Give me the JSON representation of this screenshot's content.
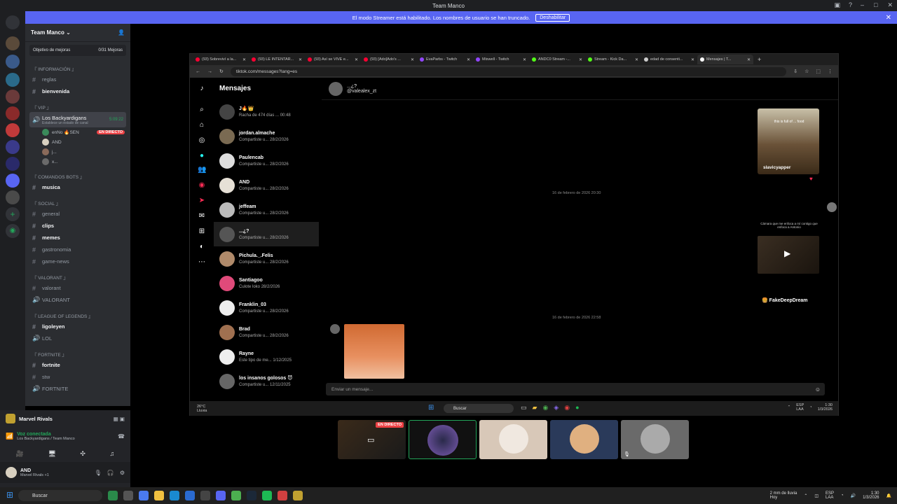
{
  "titlebar": {
    "title": "Team Manco"
  },
  "banner": {
    "text": "El modo Streamer está habilitado. Los nombres de usuario se han truncado.",
    "button": "Deshabilitar"
  },
  "server": {
    "name": "Team Manco",
    "goal_label": "Objetivo de mejoras",
    "goal_count": "0/31 Mejoras"
  },
  "channels": {
    "cat_info": "『 INFORMACIÓN 』",
    "reglas": "reglas",
    "bienvenida": "bienvenida",
    "cat_vip": "『 VIP 』",
    "voice_name": "Los Backyardigans",
    "voice_time": "5:09:22",
    "voice_status": "Establece un estado de canal",
    "vuser1": "enNo 🔥SEN",
    "vuser1_badge": "EN DIRECTO",
    "vuser2": "AND",
    "vuser3": "j...",
    "vuser4": "x...",
    "cat_bots": "『 COMANDOS BOTS 』",
    "musica": "musica",
    "cat_social": "『 SOCIAL 』",
    "general": "general",
    "clips": "clips",
    "memes": "memes",
    "gastronomia": "gastronomia",
    "game_news": "game-news",
    "cat_valorant": "『 VALORANT 』",
    "valorant": "valorant",
    "valorant_voice": "VALORANT",
    "cat_lol": "『 LEAGUE OF LEGENDS 』",
    "ligoleyen": "ligoleyen",
    "lol": "LOL",
    "cat_fortnite": "『 FORTNITE 』",
    "fortnite": "fortnite",
    "stw": "stw",
    "fortnite_voice": "FORTNITE"
  },
  "activity": {
    "game": "Marvel Rivals"
  },
  "voice_panel": {
    "status": "Voz conectada",
    "channel": "Los Backyardigans / Team Manco"
  },
  "user": {
    "name": "AND",
    "status": "Marvel Rivals +1"
  },
  "browser": {
    "tabs": [
      {
        "label": "(93) Sobreviví a la...",
        "color": "#ff0033"
      },
      {
        "label": "(93) LE INTENTAR...",
        "color": "#ff0033"
      },
      {
        "label": "(93) Así se VIVE e...",
        "color": "#ff0033"
      },
      {
        "label": "(93) [Ado]Ado's ...",
        "color": "#ff0033"
      },
      {
        "label": "EvaParbs - Twitch",
        "color": "#9146ff"
      },
      {
        "label": "Mixwell - Twitch",
        "color": "#9146ff"
      },
      {
        "label": "ANDC0 Stream -...",
        "color": "#53fc18"
      },
      {
        "label": "Stream - Kick Da...",
        "color": "#53fc18"
      },
      {
        "label": "edad de consenti...",
        "color": "#cccccc"
      },
      {
        "label": "Mensajes | T...",
        "color": "#ffffff"
      }
    ],
    "url": "tiktok.com/messages?lang=es"
  },
  "tiktok": {
    "heading": "Mensajes",
    "conversations": [
      {
        "name": "J🔥👑",
        "sub": "Racha de 474 días ...",
        "time": "00:48",
        "color": "#444"
      },
      {
        "name": "jordan.almache",
        "sub": "Compartiste u...",
        "time": "28/2/2026",
        "color": "#7a6a52"
      },
      {
        "name": "Paulencab",
        "sub": "Compartiste u...",
        "time": "28/2/2026",
        "color": "#ddd"
      },
      {
        "name": "AND",
        "sub": "Compartiste u...",
        "time": "28/2/2026",
        "color": "#e6e0d6"
      },
      {
        "name": "jeffeam",
        "sub": "Compartiste u...",
        "time": "28/2/2026",
        "color": "#bbb"
      },
      {
        "name": "...¿?",
        "sub": "Compartiste u...",
        "time": "28/2/2026",
        "color": "#555"
      },
      {
        "name": "Pichula._.Felis",
        "sub": "Compartiste u...",
        "time": "28/2/2026",
        "color": "#b08a6a"
      },
      {
        "name": "Santiagoo",
        "sub": "Culote loko",
        "time": "28/2/2026",
        "color": "#e04a7a"
      },
      {
        "name": "Franklin_03",
        "sub": "Compartiste u...",
        "time": "28/2/2026",
        "color": "#eee"
      },
      {
        "name": "Brad",
        "sub": "Compartiste u...",
        "time": "28/2/2026",
        "color": "#a07050"
      },
      {
        "name": "Rayne",
        "sub": "Este tipo de me...",
        "time": "1/12/2025",
        "color": "#eee"
      },
      {
        "name": "los insanos golosos 😈",
        "sub": "Compartiste u...",
        "time": "12/11/2025",
        "color": "#666"
      }
    ],
    "chat_name": "...¿?",
    "chat_handle": "@valealex_zt",
    "date1": "16 de febrero de 2026 20:30",
    "date2": "16 de febrero de 2026 22:58",
    "card1_user": "slavicyapper",
    "card1_caption": "this is full of ... food",
    "card2_caption": "Cámara que me enfoca a mí contigo que enfoca a Antonio",
    "card2_user": "FakeDeepDream",
    "input_placeholder": "Enviar un mensaje..."
  },
  "inner_taskbar": {
    "weather_temp": "26°C",
    "weather_desc": "Lluvia",
    "search": "Buscar",
    "lang": "ESP",
    "lang2": "LAA",
    "time": "1:30",
    "date": "1/3/2026"
  },
  "stream_tiles": {
    "live_badge": "EN DIRECTO"
  },
  "win_taskbar": {
    "search": "Buscar",
    "weather": "2 mm de lluvia",
    "weather_sub": "Hoy",
    "lang": "ESP",
    "lang2": "LAA",
    "time": "1:30",
    "date": "1/3/2026"
  }
}
